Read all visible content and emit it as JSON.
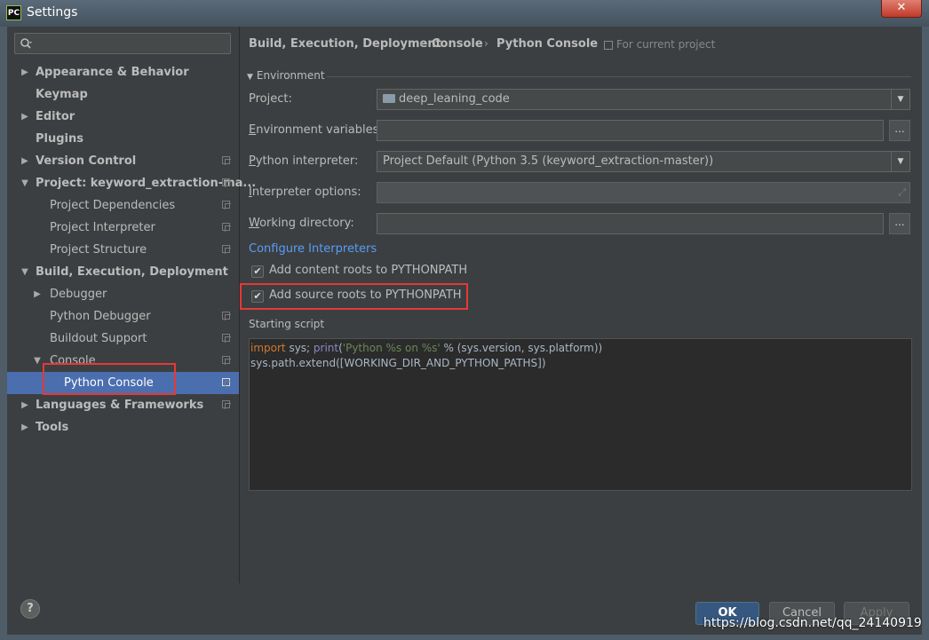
{
  "window": {
    "title": "Settings",
    "app_icon": "PC",
    "close_glyph": "✕"
  },
  "search": {
    "placeholder": "Q▾"
  },
  "tree": {
    "appearance": "Appearance & Behavior",
    "keymap": "Keymap",
    "editor": "Editor",
    "plugins": "Plugins",
    "version_control": "Version Control",
    "project": "Project: keyword_extraction-ma...",
    "project_dependencies": "Project Dependencies",
    "project_interpreter": "Project Interpreter",
    "project_structure": "Project Structure",
    "build": "Build, Execution, Deployment",
    "debugger": "Debugger",
    "python_debugger": "Python Debugger",
    "buildout_support": "Buildout Support",
    "console": "Console",
    "python_console": "Python Console",
    "languages": "Languages & Frameworks",
    "tools": "Tools"
  },
  "breadcrumb": {
    "part1": "Build, Execution, Deployment",
    "part2": "Console",
    "part3": "Python Console",
    "sep": "›",
    "scope": "For current project"
  },
  "environment": {
    "header": "Environment",
    "project_label": "Project:",
    "project_value": "deep_leaning_code",
    "env_vars_label_u": "E",
    "env_vars_label_rest": "nvironment variables:",
    "env_vars_value": "",
    "interpreter_label_u": "P",
    "interpreter_label_rest": "ython interpreter:",
    "interpreter_value": "Project Default (Python 3.5 (keyword_extraction-master))",
    "interp_options_label_u": "I",
    "interp_options_label_rest": "nterpreter options:",
    "interp_options_value": "",
    "working_dir_label_u": "W",
    "working_dir_label_rest": "orking directory:",
    "working_dir_value": "",
    "browse_label": "...",
    "configure_link": "Configure Interpreters"
  },
  "options": {
    "content_roots": {
      "label": "Add content roots to PYTHONPATH",
      "checked": true
    },
    "source_roots": {
      "label": "Add source roots to PYTHONPATH",
      "checked": true
    },
    "check_glyph": "✔"
  },
  "starting_script": {
    "label": "Starting script",
    "line1_kw": "import",
    "line1_a": " sys; ",
    "line1_fn": "print",
    "line1_b": "(",
    "line1_str1": "'Python %s on %s'",
    "line1_c": " % (sys.version, sys.platform))",
    "line2": "sys.path.extend([WORKING_DIR_AND_PYTHON_PATHS])"
  },
  "buttons": {
    "ok": "OK",
    "cancel": "Cancel",
    "apply": "Apply",
    "help": "?"
  },
  "watermark": "https://blog.csdn.net/qq_24140919",
  "colors": {
    "selection": "#4b6eaf",
    "highlight_box": "#e53935",
    "link": "#589df6"
  }
}
